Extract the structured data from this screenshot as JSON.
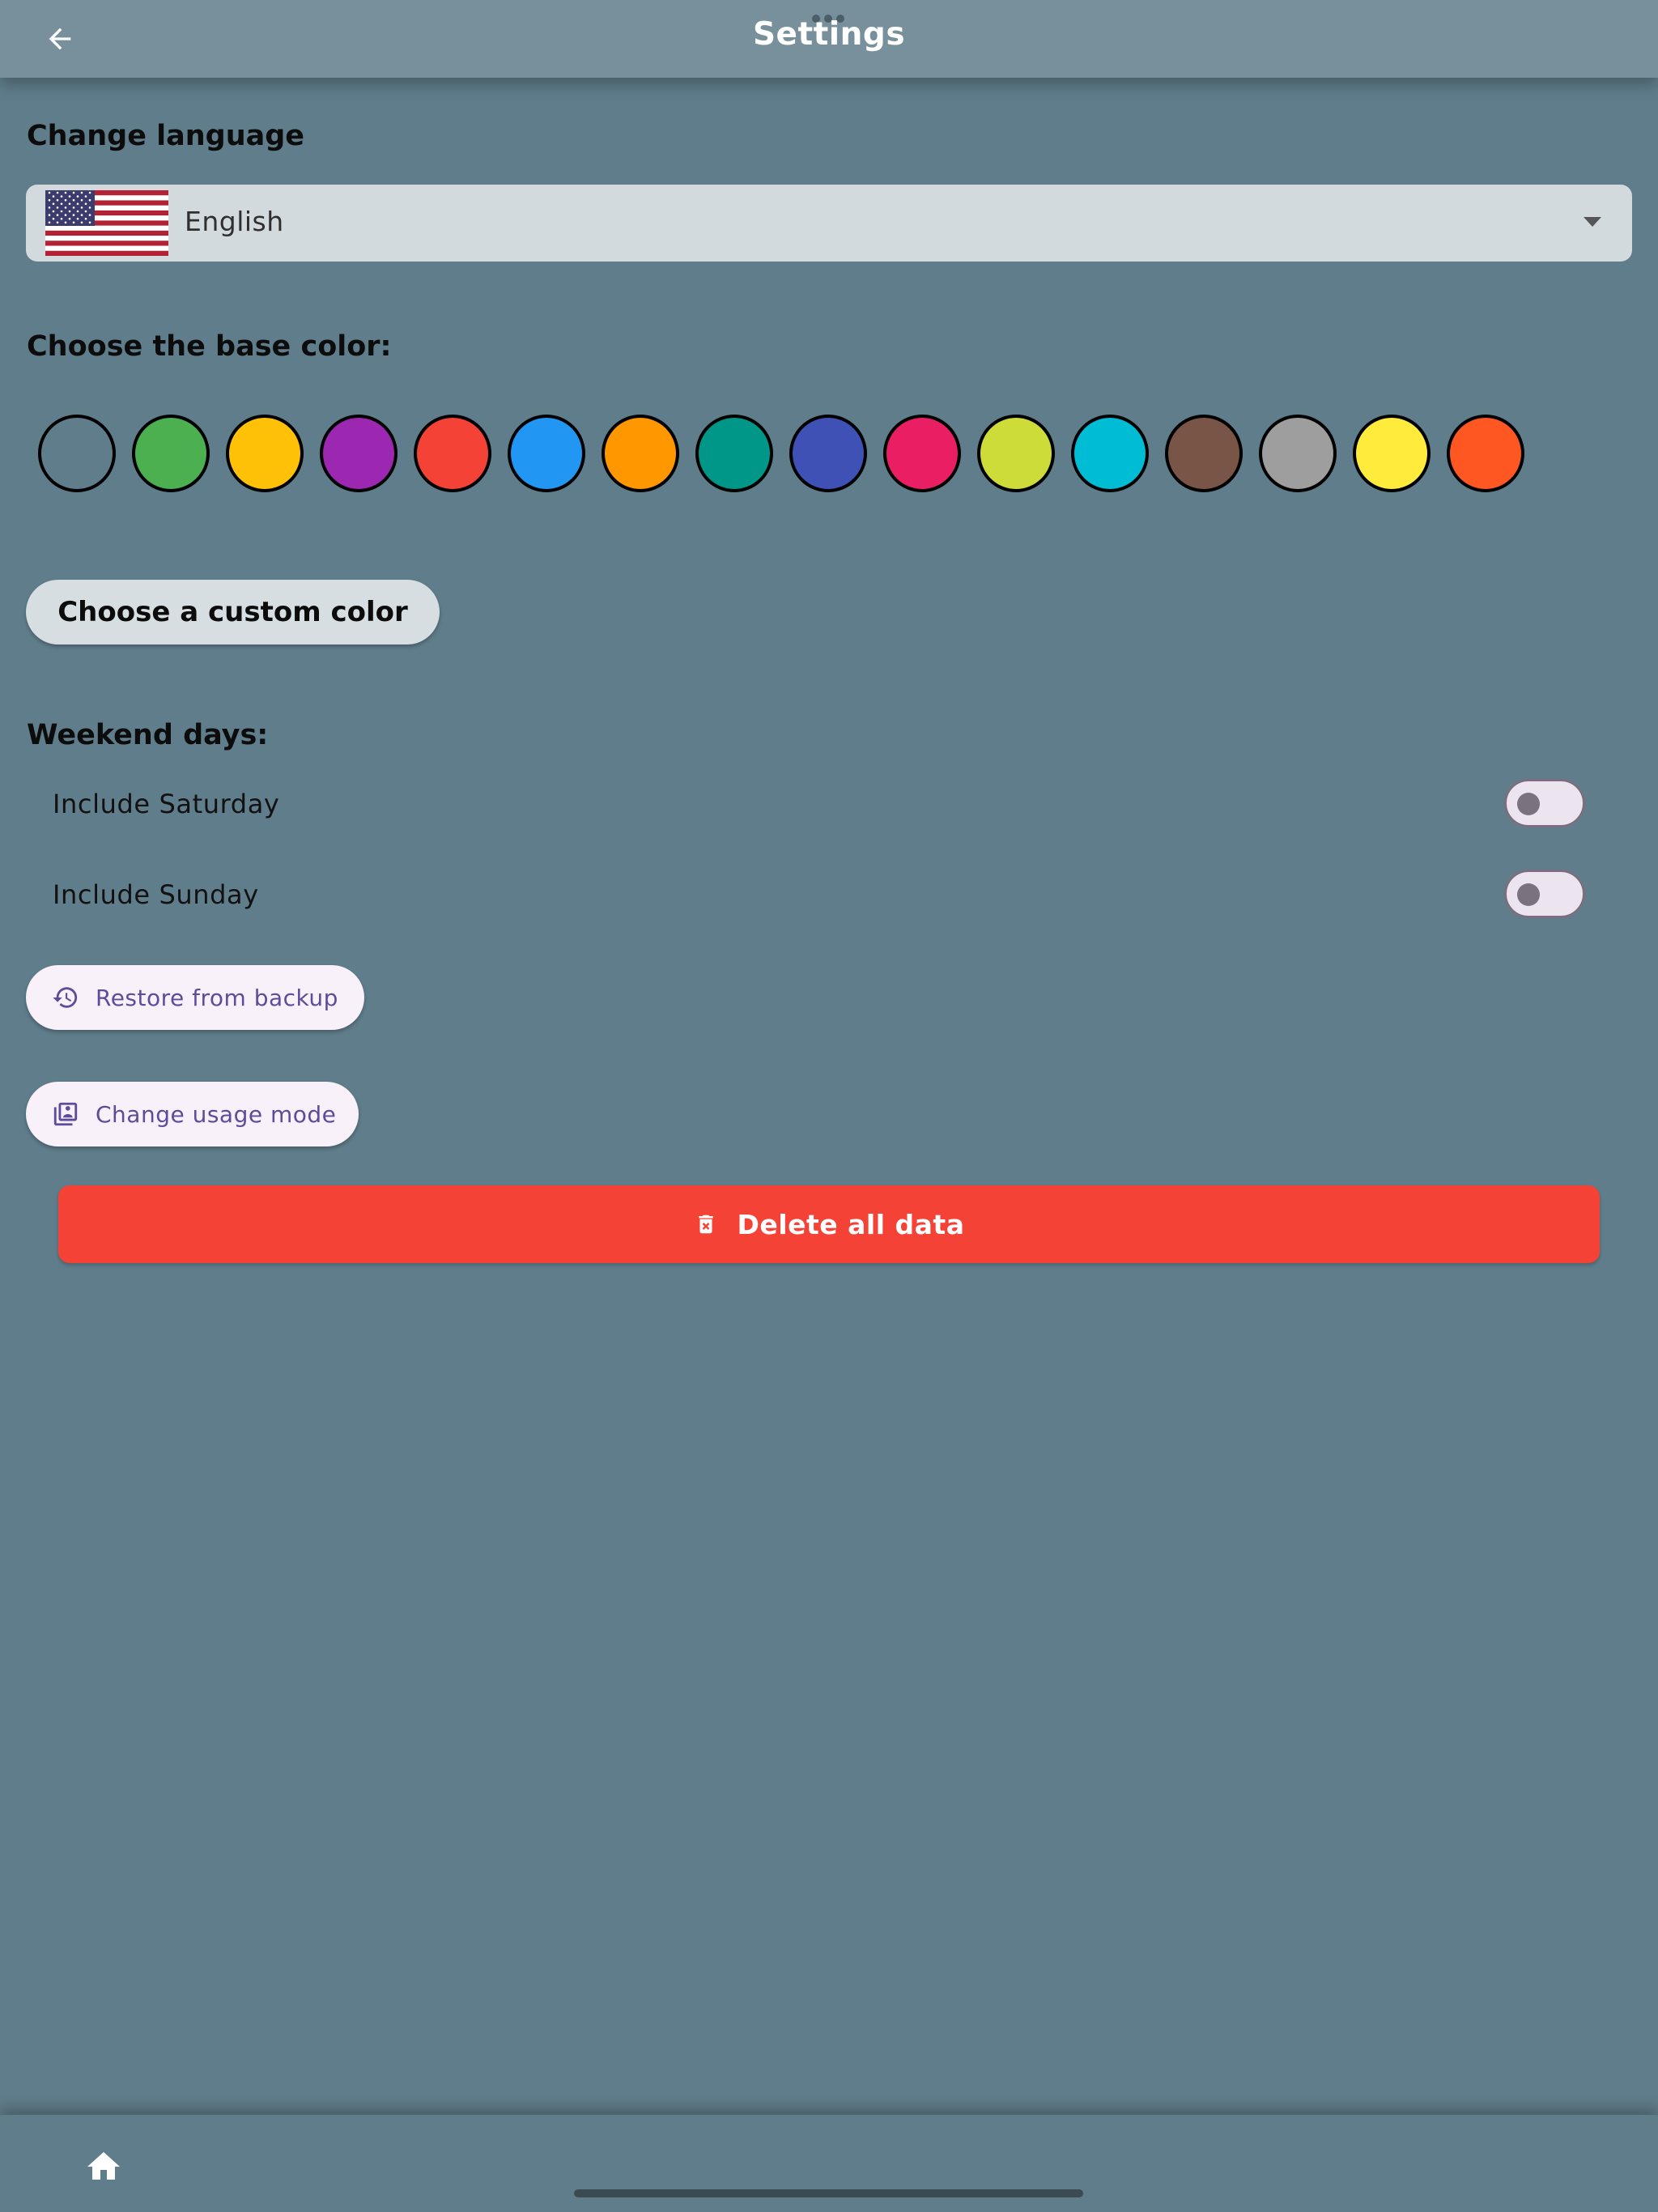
{
  "app_bar": {
    "title": "Settings",
    "back_icon": "arrow-back-icon"
  },
  "language": {
    "heading": "Change language",
    "selected": "English",
    "flag_icon": "us-flag-icon"
  },
  "base_color": {
    "heading": "Choose the base color:",
    "swatches": [
      "#607d8b",
      "#4caf50",
      "#ffc107",
      "#9c27b0",
      "#f44336",
      "#2196f3",
      "#ff9800",
      "#009688",
      "#3f51b5",
      "#e91e63",
      "#cddc39",
      "#00bcd4",
      "#795548",
      "#9e9e9e",
      "#ffeb3b",
      "#ff5722"
    ],
    "custom_button_label": "Choose a custom color"
  },
  "weekend": {
    "heading": "Weekend days:",
    "saturday_label": "Include Saturday",
    "saturday_on": false,
    "sunday_label": "Include Sunday",
    "sunday_on": false
  },
  "actions": {
    "restore_label": "Restore from backup",
    "restore_icon": "history-icon",
    "usage_label": "Change usage mode",
    "usage_icon": "library-icon",
    "delete_label": "Delete all data",
    "delete_icon": "delete-forever-icon",
    "delete_color": "#f44336"
  },
  "bottom_nav": {
    "home_icon": "home-icon"
  },
  "theme": {
    "background": "#607d8b",
    "app_bar": "#78909c",
    "accent_text": "#6650a4"
  }
}
